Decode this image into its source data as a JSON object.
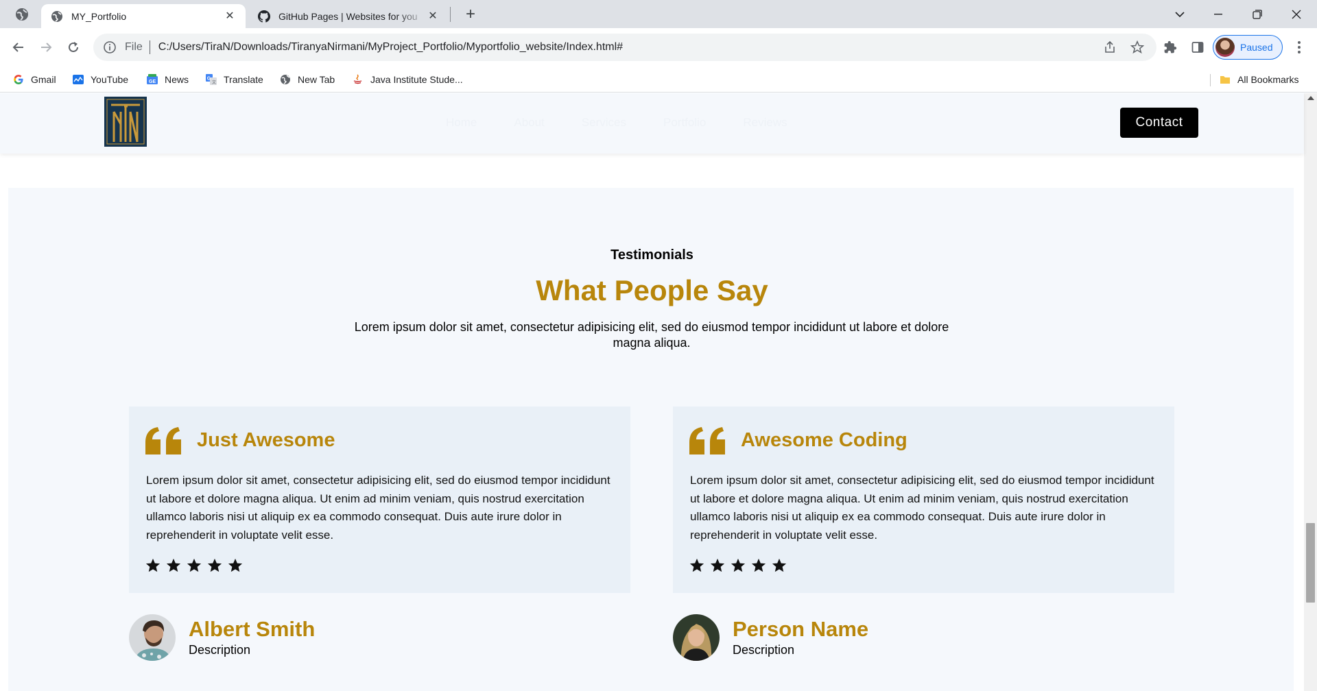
{
  "browser": {
    "tabs": [
      {
        "title": "MY_Portfolio",
        "active": true
      },
      {
        "title": "GitHub Pages | Websites for you",
        "active": false
      }
    ],
    "address": {
      "scheme_label": "File",
      "url": "C:/Users/TiraN/Downloads/TiranyaNirmani/MyProject_Portfolio/Myportfolio_website/Index.html#"
    },
    "profile_label": "Paused",
    "bookmarks": [
      {
        "label": "Gmail",
        "icon": "google-icon"
      },
      {
        "label": "YouTube",
        "icon": "youtube-icon"
      },
      {
        "label": "News",
        "icon": "news-icon"
      },
      {
        "label": "Translate",
        "icon": "translate-icon"
      },
      {
        "label": "New Tab",
        "icon": "globe-icon"
      },
      {
        "label": "Java Institute Stude...",
        "icon": "java-icon"
      }
    ],
    "all_bookmarks_label": "All Bookmarks"
  },
  "site": {
    "nav": [
      "Home",
      "About",
      "Services",
      "Portfolio",
      "Reviews"
    ],
    "contact_label": "Contact",
    "testimonials": {
      "eyebrow": "Testimonials",
      "title": "What People Say",
      "description": "Lorem ipsum dolor sit amet, consectetur adipisicing elit, sed do eiusmod tempor incididunt ut labore et dolore magna aliqua.",
      "cards": [
        {
          "title": "Just Awesome",
          "text": "Lorem ipsum dolor sit amet, consectetur adipisicing elit, sed do eiusmod tempor incididunt ut labore et dolore magna aliqua. Ut enim ad minim veniam, quis nostrud exercitation ullamco laboris nisi ut aliquip ex ea commodo consequat. Duis aute irure dolor in reprehenderit in voluptate velit esse.",
          "rating": 5,
          "author_name": "Albert Smith",
          "author_desc": "Description"
        },
        {
          "title": "Awesome Coding",
          "text": "Lorem ipsum dolor sit amet, consectetur adipisicing elit, sed do eiusmod tempor incididunt ut labore et dolore magna aliqua. Ut enim ad minim veniam, quis nostrud exercitation ullamco laboris nisi ut aliquip ex ea commodo consequat. Duis aute irure dolor in reprehenderit in voluptate velit esse.",
          "rating": 5,
          "author_name": "Person Name",
          "author_desc": "Description"
        }
      ]
    }
  },
  "colors": {
    "accent_gold": "#b8860b",
    "section_bg": "#f5f8fc",
    "card_bg": "#e9f0f7",
    "logo_bg": "#16344d"
  }
}
